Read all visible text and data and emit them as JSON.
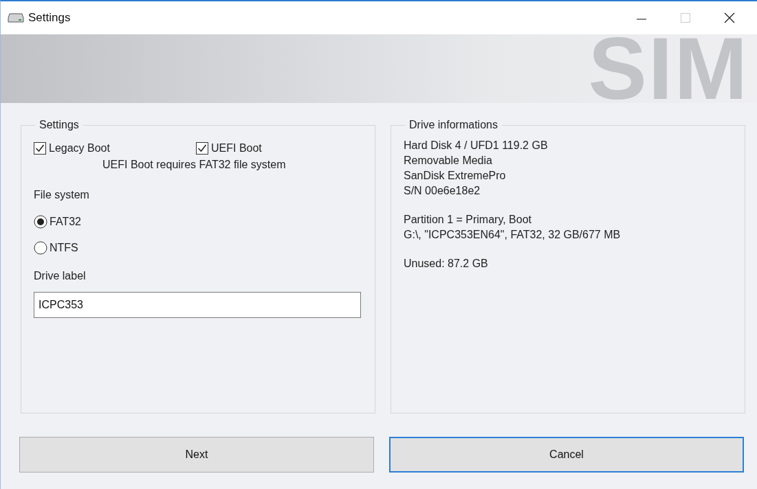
{
  "window": {
    "title": "Settings"
  },
  "banner": {
    "logo_text": "SIM"
  },
  "settings": {
    "title": "Settings",
    "boot_options": [
      {
        "label": "Legacy Boot",
        "checked": true
      },
      {
        "label": "UEFI Boot",
        "checked": true
      }
    ],
    "boot_note": "UEFI Boot requires FAT32 file system",
    "file_system_label": "File system",
    "file_systems": [
      {
        "label": "FAT32",
        "selected": true
      },
      {
        "label": "NTFS",
        "selected": false
      }
    ],
    "drive_label_label": "Drive label",
    "drive_label_value": "ICPC353"
  },
  "drive_info": {
    "title": "Drive informations",
    "blocks": [
      [
        "Hard Disk 4 / UFD1 119.2 GB",
        "Removable Media",
        "SanDisk ExtremePro",
        "S/N 00e6e18e2"
      ],
      [
        "Partition 1 = Primary, Boot",
        "G:\\, \"ICPC353EN64\", FAT32, 32 GB/677 MB"
      ],
      [
        "Unused: 87.2 GB"
      ]
    ]
  },
  "buttons": [
    {
      "label": "Next",
      "focused": false
    },
    {
      "label": "Cancel",
      "focused": true
    }
  ]
}
